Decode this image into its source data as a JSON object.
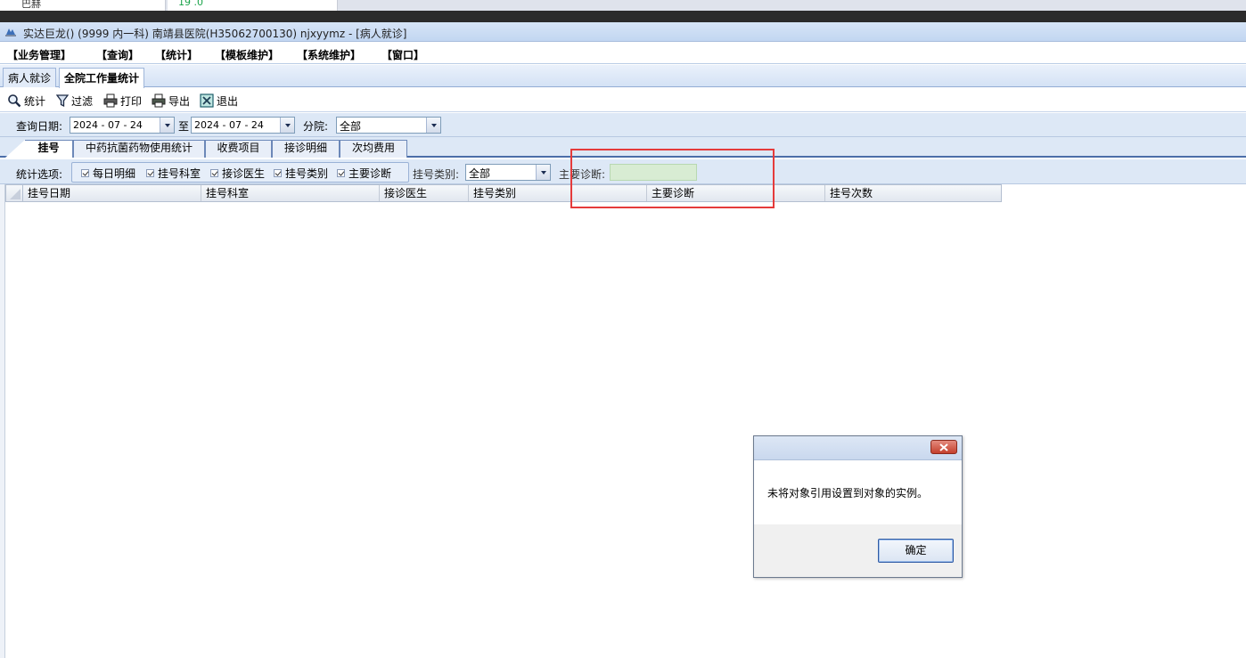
{
  "browser": {
    "tab_fragment_1": "巴赫",
    "tab_fragment_2": "19 .0"
  },
  "window": {
    "title": "实达巨龙() (9999 内一科) 南靖县医院(H35062700130) njxyymz - [病人就诊]"
  },
  "menu": {
    "items": [
      "【业务管理】",
      "【查询】",
      "【统计】",
      "【模板维护】",
      "【系统维护】",
      "【窗口】"
    ]
  },
  "doc_tabs": {
    "items": [
      "病人就诊",
      "全院工作量统计"
    ],
    "active": 1
  },
  "toolbar": {
    "stat": "统计",
    "filter": "过滤",
    "print": "打印",
    "export": "导出",
    "exit": "退出"
  },
  "query": {
    "date_label": "查询日期:",
    "date_from": "2024 - 07 - 24",
    "to_label": "至",
    "date_to": "2024 - 07 - 24",
    "branch_label": "分院:",
    "branch_value": "全部"
  },
  "report_tabs": {
    "items": [
      "挂号",
      "中药抗菌药物使用统计",
      "收费项目",
      "接诊明细",
      "次均费用"
    ],
    "active": 0
  },
  "options": {
    "label": "统计选项:",
    "checks": [
      "每日明细",
      "挂号科室",
      "接诊医生",
      "挂号类别",
      "主要诊断"
    ],
    "reg_type_label": "挂号类别:",
    "reg_type_value": "全部",
    "diag_label": "主要诊断:",
    "diag_value": ""
  },
  "grid": {
    "columns": [
      "挂号日期",
      "挂号科室",
      "接诊医生",
      "挂号类别",
      "主要诊断",
      "挂号次数"
    ]
  },
  "dialog": {
    "message": "未将对象引用设置到对象的实例。",
    "ok": "确定"
  }
}
